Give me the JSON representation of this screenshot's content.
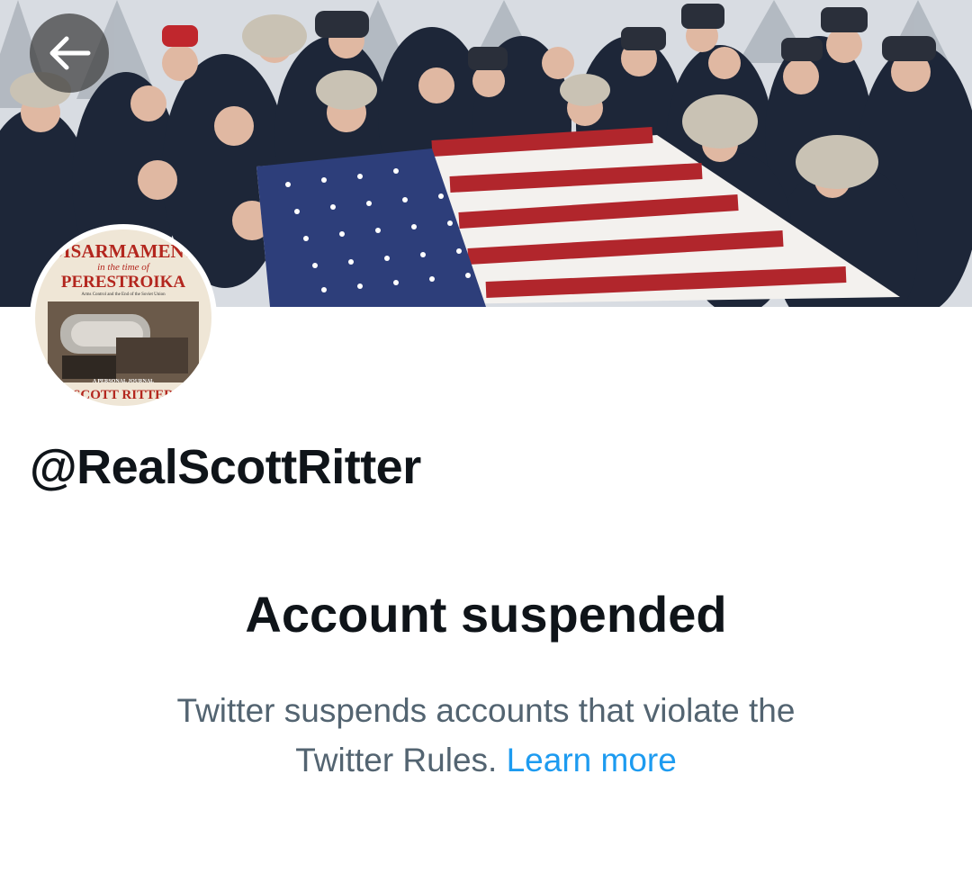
{
  "app": "Twitter",
  "header": {
    "back_icon": "arrow-left-icon",
    "banner_image": "group photo of people in winter coats holding an American flag"
  },
  "profile": {
    "avatar": {
      "book_title_line1": "DISARMAMENT",
      "book_title_line2": "in the time of",
      "book_title_line3": "PERESTROIKA",
      "book_subtitle": "Arms Control and the End of the Soviet Union",
      "book_tag": "A PERSONAL JOURNAL",
      "book_author": "SCOTT RITTER"
    },
    "handle": "@RealScottRitter"
  },
  "suspension": {
    "title": "Account suspended",
    "message": "Twitter suspends accounts that violate the Twitter Rules.",
    "link_label": "Learn more"
  },
  "colors": {
    "text_primary": "#0f1419",
    "text_secondary": "#536471",
    "link": "#1d9bf0"
  }
}
